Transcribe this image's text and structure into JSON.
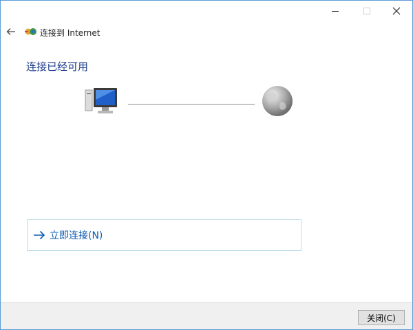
{
  "window": {
    "title": "连接到 Internet",
    "controls": {
      "minimize": "minimize",
      "maximize": "maximize",
      "close": "close"
    }
  },
  "nav": {
    "back_icon": "back-arrow-icon"
  },
  "main": {
    "heading": "连接已经可用",
    "option_label": "立即连接(N)"
  },
  "footer": {
    "close_label": "关闭(C)"
  },
  "colors": {
    "heading": "#1f3d8c",
    "link": "#0b5bb3",
    "option_border": "#bcdbea",
    "footer_bg": "#f0f0f0",
    "window_border": "#5a9bd5"
  }
}
